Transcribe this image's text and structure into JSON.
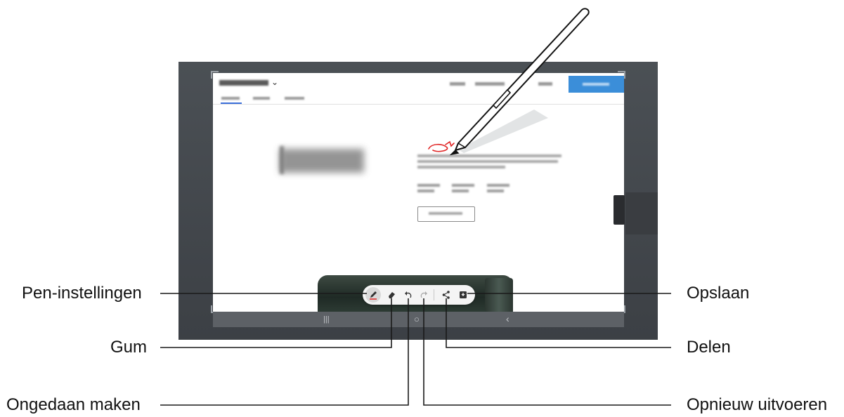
{
  "callouts": {
    "pen_settings": "Pen-instellingen",
    "eraser": "Gum",
    "undo": "Ongedaan maken",
    "save": "Opslaan",
    "share": "Delen",
    "redo": "Opnieuw uitvoeren"
  },
  "toolbar_tools": [
    "pen-icon",
    "eraser-icon",
    "undo-icon",
    "redo-icon",
    "share-icon",
    "save-icon"
  ],
  "navbar_glyphs": {
    "recents": "|||",
    "home": "○",
    "back": "‹"
  },
  "colors": {
    "accent_button": "#3b8ed9",
    "scribble": "#e02424",
    "callout_line": "#1a1a1a"
  }
}
